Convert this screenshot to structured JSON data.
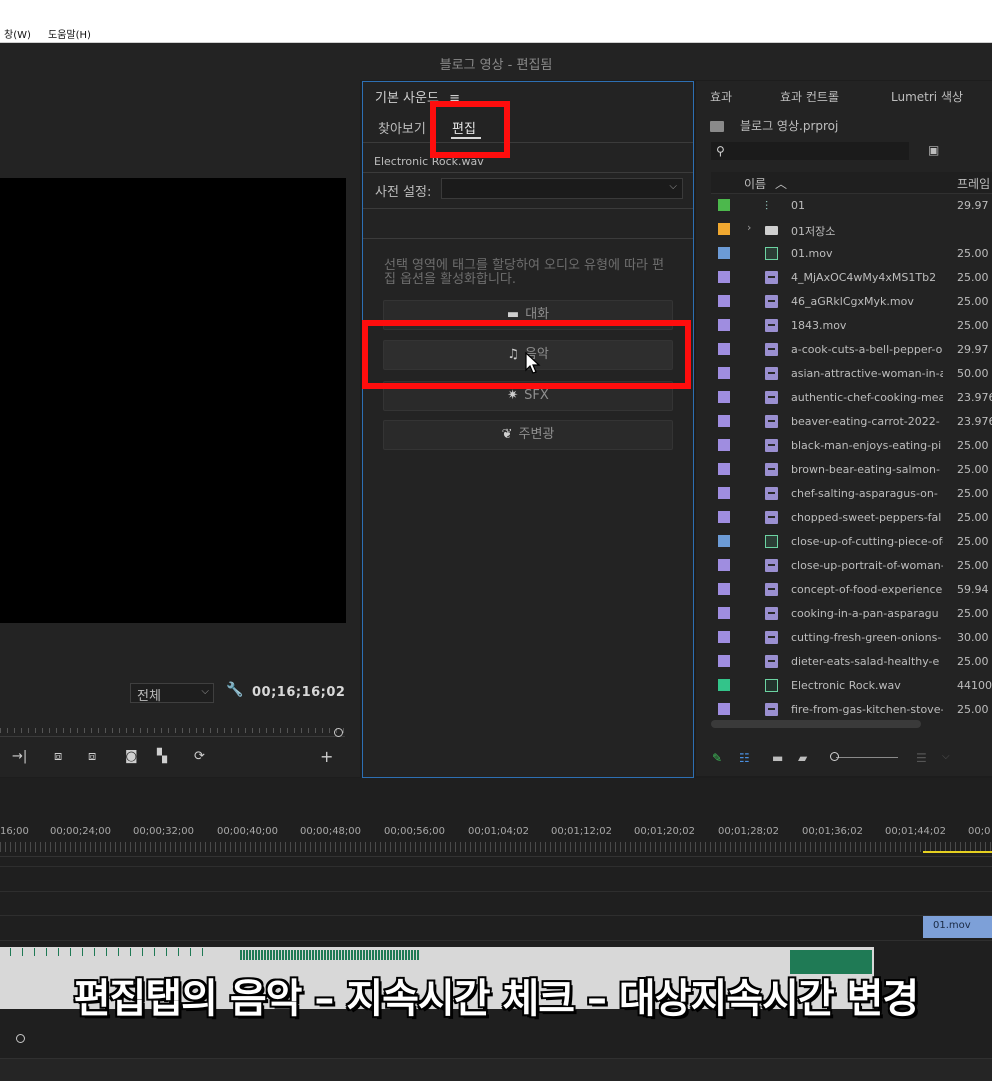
{
  "menu": {
    "window": "창(W)",
    "help": "도움말(H)"
  },
  "window_title": "블로그 영상 - 편집됨",
  "monitor": {
    "fit": "전체",
    "timecode": "00;16;16;02"
  },
  "essential_sound": {
    "title": "기본 사운드",
    "menu_glyph": "≡",
    "tabs": [
      "찾아보기",
      "편집"
    ],
    "filename": "Electronic Rock.wav",
    "preset_label": "사전 설정:",
    "hint": "선택 영역에 태그를 할당하여 오디오 유형에 따라 편집 옵션을 활성화합니다.",
    "buttons": {
      "dialogue": "대화",
      "music": "음악",
      "sfx": "SFX",
      "ambience": "주변광"
    }
  },
  "project": {
    "tabs": [
      "효과",
      "효과 컨트롤",
      "Lumetri 색상"
    ],
    "name": "블로그 영상.prproj",
    "col_name": "이름",
    "col_rate": "프레임",
    "rows": [
      {
        "name": "01",
        "rate": "29.97",
        "color": "#4cb84c",
        "icon": "sequence-icon"
      },
      {
        "name": "01저장소",
        "rate": "",
        "color": "#f0a830",
        "icon": "folder-icon"
      },
      {
        "name": "01.mov",
        "rate": "25.00",
        "color": "#6c9bd6",
        "icon": "av-clip-icon"
      },
      {
        "name": "4_MjAxOC4wMy4xMS1Tb2",
        "rate": "25.00",
        "color": "#9f8de0",
        "icon": "clip-icon"
      },
      {
        "name": "46_aGRklCgxMyk.mov",
        "rate": "25.00",
        "color": "#9f8de0",
        "icon": "clip-icon"
      },
      {
        "name": "1843.mov",
        "rate": "25.00",
        "color": "#9f8de0",
        "icon": "clip-icon"
      },
      {
        "name": "a-cook-cuts-a-bell-pepper-o",
        "rate": "29.97",
        "color": "#9f8de0",
        "icon": "clip-icon"
      },
      {
        "name": "asian-attractive-woman-in-a",
        "rate": "50.00",
        "color": "#9f8de0",
        "icon": "clip-icon"
      },
      {
        "name": "authentic-chef-cooking-mea",
        "rate": "23.976",
        "color": "#9f8de0",
        "icon": "clip-icon"
      },
      {
        "name": "beaver-eating-carrot-2022-",
        "rate": "23.976",
        "color": "#9f8de0",
        "icon": "clip-icon"
      },
      {
        "name": "black-man-enjoys-eating-pi",
        "rate": "25.00",
        "color": "#9f8de0",
        "icon": "clip-icon"
      },
      {
        "name": "brown-bear-eating-salmon-",
        "rate": "25.00",
        "color": "#9f8de0",
        "icon": "clip-icon"
      },
      {
        "name": "chef-salting-asparagus-on-",
        "rate": "25.00",
        "color": "#9f8de0",
        "icon": "clip-icon"
      },
      {
        "name": "chopped-sweet-peppers-fal",
        "rate": "25.00",
        "color": "#9f8de0",
        "icon": "clip-icon"
      },
      {
        "name": "close-up-of-cutting-piece-of-",
        "rate": "25.00",
        "color": "#6c9bd6",
        "icon": "av-clip-icon"
      },
      {
        "name": "close-up-portrait-of-woman-",
        "rate": "25.00",
        "color": "#9f8de0",
        "icon": "clip-icon"
      },
      {
        "name": "concept-of-food-experience",
        "rate": "59.94",
        "color": "#9f8de0",
        "icon": "clip-icon"
      },
      {
        "name": "cooking-in-a-pan-asparagu",
        "rate": "25.00",
        "color": "#9f8de0",
        "icon": "clip-icon"
      },
      {
        "name": "cutting-fresh-green-onions-",
        "rate": "30.00",
        "color": "#9f8de0",
        "icon": "clip-icon"
      },
      {
        "name": "dieter-eats-salad-healthy-e",
        "rate": "25.00",
        "color": "#9f8de0",
        "icon": "clip-icon"
      },
      {
        "name": "Electronic Rock.wav",
        "rate": "44100",
        "color": "#33c48a",
        "icon": "audio-clip-icon"
      },
      {
        "name": "fire-from-gas-kitchen-stove-",
        "rate": "25.00",
        "color": "#9f8de0",
        "icon": "clip-icon"
      }
    ]
  },
  "timeline": {
    "ticks": [
      "16;00",
      "00;00;24;00",
      "00;00;32;00",
      "00;00;40;00",
      "00;00;48;00",
      "00;00;56;00",
      "00;01;04;02",
      "00;01;12;02",
      "00;01;20;02",
      "00;01;28;02",
      "00;01;36;02",
      "00;01;44;02",
      "00;0"
    ],
    "video_clip": "01.mov"
  },
  "caption": "편집탭의 음악 – 지속시간 체크 – 대상지속시간 변경",
  "colors": {
    "highlight": "#ff0d0d",
    "panel_focus": "#2d6fb3",
    "audio_wave": "#1f7a55",
    "video_clip": "#7da0d8"
  }
}
